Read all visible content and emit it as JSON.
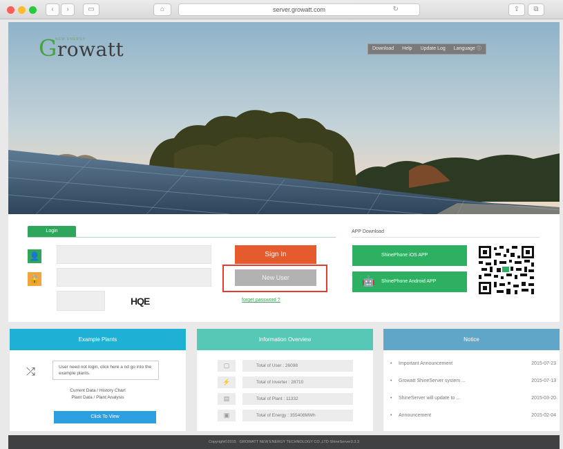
{
  "browser": {
    "url": "server.growatt.com",
    "reload_icon": "reload-icon",
    "nav_back": "‹",
    "nav_forward": "›"
  },
  "header": {
    "logo_initial": "G",
    "logo_rest": "rowatt",
    "logo_tagline": "NEW ENERGY",
    "nav": [
      "Download",
      "Help",
      "Update Log",
      "Language ⓘ"
    ]
  },
  "login": {
    "tab_label": "Login",
    "captcha": "HQE",
    "sign_in": "Sign In",
    "new_user": "New User",
    "forgot": "forget password ?"
  },
  "app_download": {
    "title": "APP Download",
    "ios": "ShinePhone iOS APP",
    "android": "ShinePhone Android APP"
  },
  "example_plants": {
    "title": "Example Plants",
    "note": "User need not login, click here a nd go into the example plants.",
    "line1": "Current Data / History Chart",
    "line2": "Plant Data / Plant Analysis",
    "button": "Click To View"
  },
  "info_overview": {
    "title": "Information Overview",
    "rows": [
      {
        "label": "Total of User :  26098",
        "icon": "user-icon"
      },
      {
        "label": "Total of Inverter :  28710",
        "icon": "inverter-icon"
      },
      {
        "label": "Total of Plant :  11332",
        "icon": "plant-icon"
      },
      {
        "label": "Total of Energy :  355408MWh",
        "icon": "energy-icon"
      }
    ]
  },
  "notice": {
    "title": "Notice",
    "rows": [
      {
        "title": "Important Announcement",
        "date": "2015-07-23"
      },
      {
        "title": "Growatt ShineServer system ...",
        "date": "2015-07-13"
      },
      {
        "title": "ShineServer will update to ...",
        "date": "2015-03-20"
      },
      {
        "title": "Announcement",
        "date": "2015-02-04"
      }
    ]
  },
  "footer": {
    "text": "Copyright©2015 · GROWATT NEW ENERGY TECHNOLOGY CO.,LTD·ShineServer3.3.3"
  },
  "colors": {
    "green": "#2ea65b",
    "orange": "#e65b2e",
    "blue_head": "#1fb0d6",
    "teal_head": "#57c7b6",
    "steel_head": "#5fa6c8",
    "alert": "#e53a2f"
  }
}
